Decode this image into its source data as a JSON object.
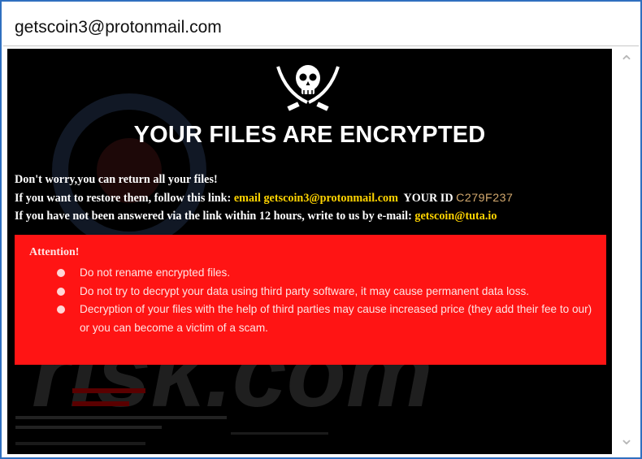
{
  "window": {
    "title": "getscoin3@protonmail.com"
  },
  "note": {
    "heading": "YOUR FILES ARE ENCRYPTED",
    "line1": "Don't worry,you can return all your files!",
    "line2_prefix": "If you want to restore them, follow this link: ",
    "line2_link": "email getscoin3@protonmail.com",
    "line2_id_label": "  YOUR ID ",
    "line2_id_value": "C279F237",
    "line3_prefix": "If you have not been answered via the link within 12 hours, write to us by e-mail: ",
    "line3_email": "getscoin@tuta.io",
    "attention_title": "Attention!",
    "bullets": [
      "Do not rename encrypted files.",
      "Do not try to decrypt your data using third party software, it may cause permanent data loss.",
      "Decryption of your files with the help of third parties may cause increased price (they add their fee to our) or you can become a victim of a scam."
    ]
  },
  "watermark": {
    "text": "risk.com"
  },
  "colors": {
    "background": "#000000",
    "alert_box": "#ff1414",
    "link": "#ffd400",
    "frame": "#2f6fbf"
  },
  "icons": {
    "scroll_up": "chevron-up-icon",
    "scroll_down": "chevron-down-icon",
    "logo": "jolly-roger-icon"
  }
}
